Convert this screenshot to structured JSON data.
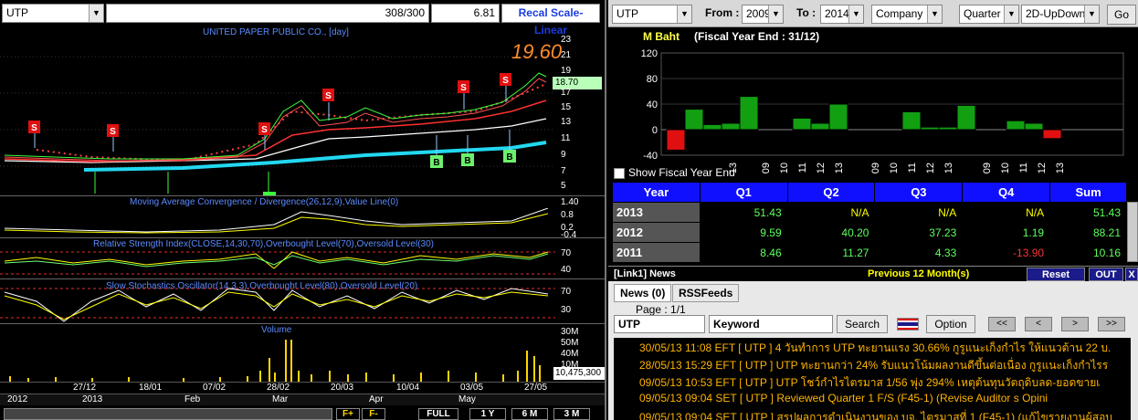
{
  "chart_toolbar": {
    "symbol": "UTP",
    "counter": "308/300",
    "value": "6.81",
    "scale_label": "Recal Scale-Linear"
  },
  "chart": {
    "title": "UNITED PAPER PUBLIC CO., [day]",
    "last_price": "19.60",
    "price_tag": "18.70",
    "price_axis": [
      "23",
      "21",
      "19",
      "17",
      "15",
      "13",
      "11",
      "9",
      "7",
      "5"
    ],
    "signal_labels": {
      "sell": "S",
      "buy": "B"
    },
    "macd_title": "Moving Average Convergence / Divergence(26,12,9),Value Line(0)",
    "macd_axis": [
      "1.40",
      "0.8",
      "0.2",
      "-0.4"
    ],
    "rsi_title": "Relative Strength Index(CLOSE,14,30,70),Overbought Level(70),Oversold Level(30)",
    "rsi_axis": [
      "70",
      "40"
    ],
    "sto_title": "Slow Stochastics Oscillator(14,3,3),Overbought Level(80),Oversold Level(20)",
    "sto_axis": [
      "70",
      "30"
    ],
    "volume_title": "Volume",
    "volume_axis": [
      "30M",
      "50M",
      "40M",
      "10M"
    ],
    "volume_tag": "10,475,300",
    "dates_top": [
      "27/12",
      "18/01",
      "07/02",
      "28/02",
      "20/03",
      "10/04",
      "03/05",
      "27/05"
    ],
    "dates_bottom": [
      "2012",
      "2013",
      "Feb",
      "Mar",
      "Apr",
      "May"
    ],
    "bottom_buttons": [
      "F+",
      "F-",
      "FULL",
      "1 Y",
      "6 M",
      "3 M"
    ]
  },
  "fin_toolbar": {
    "symbol": "UTP",
    "from_label": "From :",
    "from_value": "2009",
    "to_label": "To :",
    "to_value": "2014",
    "type": "Company",
    "period": "Quarter",
    "view": "2D-UpDown",
    "go_label": "Go"
  },
  "fin_chart": {
    "unit": "M Baht",
    "fiscal_label": "(Fiscal Year End : 31/12)",
    "show_fiscal_label": "Show Fiscal Year End",
    "y_ticks": [
      "120",
      "80",
      "40",
      "0",
      "-40"
    ],
    "x_labels": [
      "13",
      "09",
      "10",
      "11",
      "12",
      "13",
      "09",
      "10",
      "11",
      "12",
      "13",
      "09",
      "10",
      "11",
      "12",
      "13"
    ]
  },
  "chart_data": {
    "type": "bar",
    "ylim": [
      -40,
      120
    ],
    "groups": [
      {
        "values": [
          -32,
          32,
          8,
          10,
          52
        ]
      },
      {
        "values": [
          18,
          10,
          40
        ]
      },
      {
        "values": [
          28,
          4,
          4,
          38
        ]
      },
      {
        "values": [
          14,
          10,
          -14
        ]
      }
    ],
    "colors": {
      "positive": "#12a012",
      "negative": "#e01010"
    }
  },
  "fin_table": {
    "headers": [
      "Year",
      "Q1",
      "Q2",
      "Q3",
      "Q4",
      "Sum"
    ],
    "rows": [
      {
        "year": "2013",
        "q1": "51.43",
        "q2": "N/A",
        "q3": "N/A",
        "q4": "N/A",
        "sum": "51.43"
      },
      {
        "year": "2012",
        "q1": "9.59",
        "q2": "40.20",
        "q3": "37.23",
        "q4": "1.19",
        "sum": "88.21"
      },
      {
        "year": "2011",
        "q1": "8.46",
        "q2": "11.27",
        "q3": "4.33",
        "q4": "-13.90",
        "sum": "10.16"
      }
    ]
  },
  "news": {
    "bar_title": "[Link1] News",
    "filter_label": "Previous 12 Month(s)",
    "reset_label": "Reset",
    "out_label": "OUT",
    "close_label": "X",
    "tabs": [
      "News (0)",
      "RSSFeeds"
    ],
    "page_label": "Page : 1/1",
    "symbol_input": "UTP",
    "keyword_placeholder": "Keyword",
    "search_label": "Search",
    "option_label": "Option",
    "nav": [
      "<<",
      "<",
      ">",
      ">>"
    ],
    "items": [
      "30/05/13 11:08  EFT  [ UTP ]  4 วันทำการ UTP ทะยานแรง 30.66% กูรูแนะเก็งกำไร ให้แนวต้าน 22 บ.",
      "28/05/13 15:29  EFT  [ UTP ]  UTP ทะยานกว่า 24% รับแนวโน้มผลงานดีขึ้นต่อเนื่อง กูรูแนะเก็งกำไรร",
      "09/05/13 10:53  EFT  [ UTP ]  UTP โชว์กำไรไตรมาส 1/56 พุ่ง 294% เหตุต้นทุนวัตถุดิบลด-ยอดขายเ",
      "09/05/13 09:04  SET  [ UTP ]  Reviewed Quarter 1 F/S (F45-1) (Revise Auditor s Opini",
      "09/05/13 09:04  SET  [ UTP ]  สรุปผลการดำเนินงานของ บจ. ไตรมาสที่ 1 (F45-1) (แก้ไขรายงานผู้สอบ"
    ]
  }
}
